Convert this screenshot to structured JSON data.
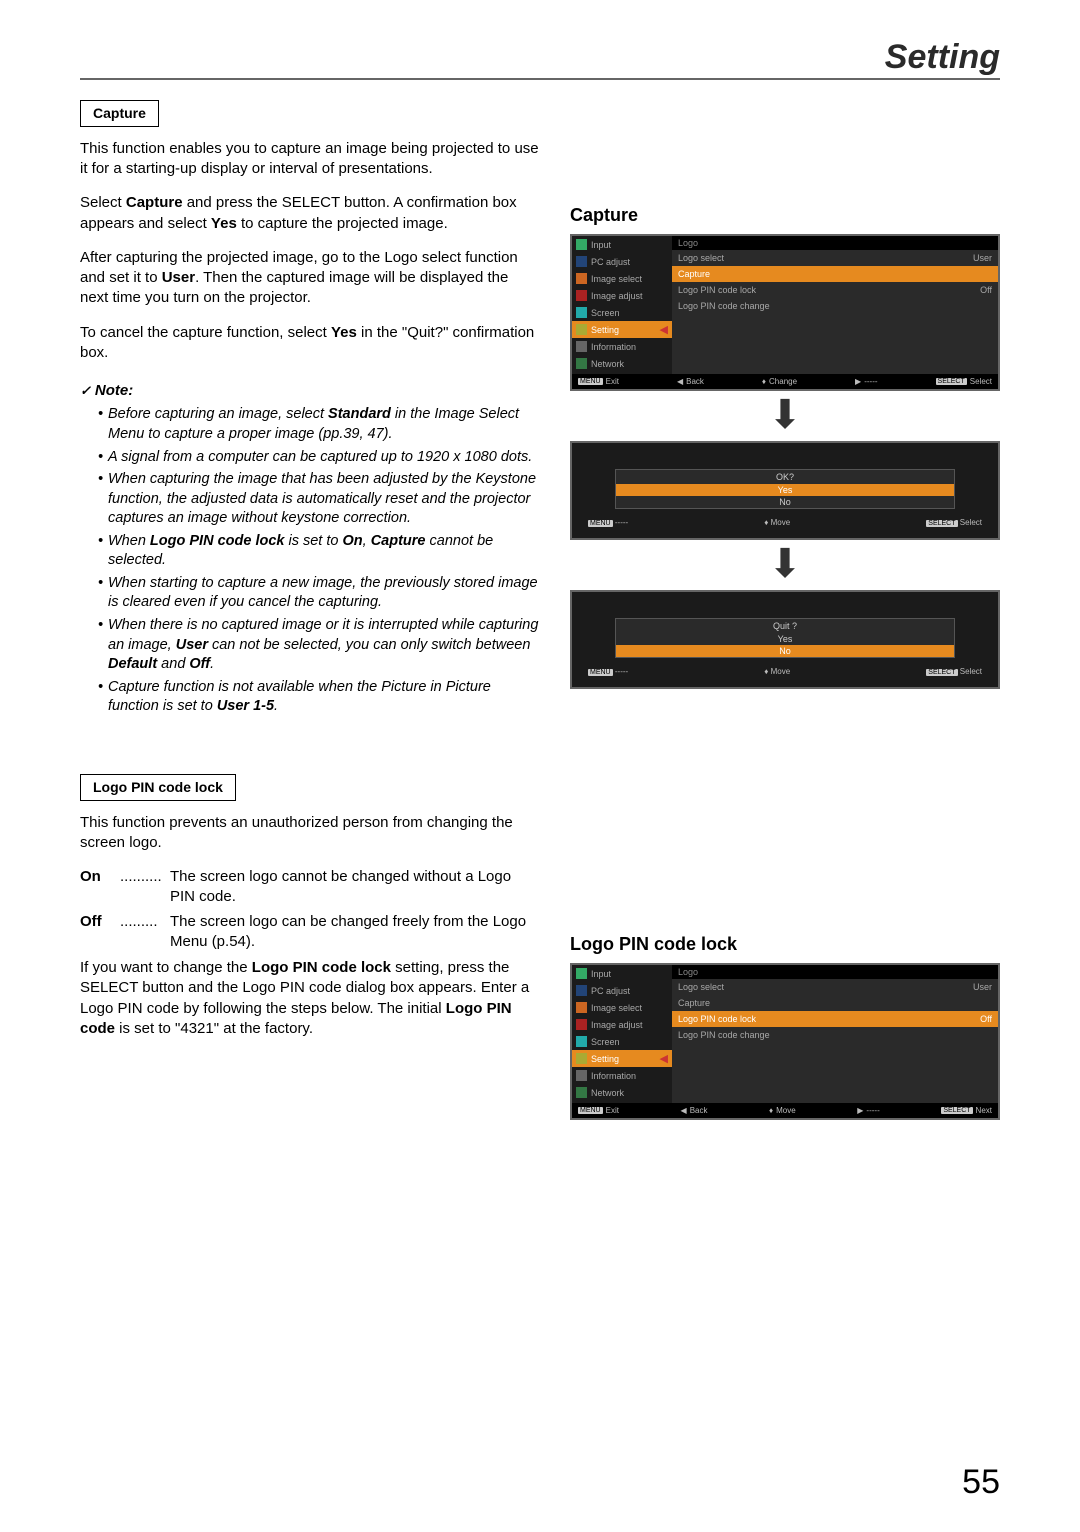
{
  "header": {
    "title": "Setting"
  },
  "page_number": "55",
  "capture_section": {
    "label": "Capture",
    "intro": "This function enables you to capture an image being projected to use it for a starting-up display or interval of presentations.",
    "p1": "Select Capture and press the SELECT button. A confirmation box appears and select Yes to capture the projected image.",
    "p2": "After capturing the projected image, go to the Logo select function and set it to User. Then the captured image will be displayed the next time you turn on the projector.",
    "p3": "To cancel the capture function, select Yes in the \"Quit?\" confirmation box.",
    "note_heading": "Note:",
    "notes": [
      "Before capturing an image, select Standard in the Image Select Menu to capture a proper image (pp.39, 47).",
      "A signal from a computer can be captured up to 1920 x 1080 dots.",
      "When capturing the image that has been adjusted by the Keystone function, the adjusted data is automatically reset and the projector captures an image without keystone correction.",
      "When Logo PIN code lock is set to On, Capture cannot be selected.",
      "When starting to capture a new image, the previously stored image is cleared even if you cancel the capturing.",
      "When there is no captured image or it is interrupted while capturing an image, User can not be selected, you can only switch between Default and Off.",
      "Capture function is not available when the Picture in Picture function is set to User 1-5."
    ]
  },
  "logo_section": {
    "label": "Logo PIN code lock",
    "intro": "This function prevents an unauthorized person from changing the screen logo.",
    "on_label": "On",
    "on_text": "The screen logo cannot be changed without a Logo PIN code.",
    "off_label": "Off",
    "off_text": "The screen logo can be changed freely from the Logo Menu (p.54).",
    "p_after": "If you want to change the Logo PIN code lock setting, press the SELECT button and the Logo PIN code dialog box appears. Enter a Logo PIN code by following the steps below. The initial Logo PIN code is set to \"4321\" at the factory."
  },
  "right": {
    "capture_heading": "Capture",
    "logo_heading": "Logo PIN code lock"
  },
  "menu": {
    "sidebar": [
      {
        "label": "Input",
        "ico": "ico-green"
      },
      {
        "label": "PC adjust",
        "ico": "ico-blue"
      },
      {
        "label": "Image select",
        "ico": "ico-orange"
      },
      {
        "label": "Image adjust",
        "ico": "ico-red"
      },
      {
        "label": "Screen",
        "ico": "ico-cyan"
      },
      {
        "label": "Setting",
        "ico": "ico-yellow",
        "selected": true
      },
      {
        "label": "Information",
        "ico": "ico-grey"
      },
      {
        "label": "Network",
        "ico": "ico-net"
      }
    ],
    "logo_header": "Logo",
    "options_capture": [
      {
        "label": "Logo select",
        "value": "User"
      },
      {
        "label": "Capture",
        "value": "",
        "selected": true
      },
      {
        "label": "Logo PIN code lock",
        "value": "Off"
      },
      {
        "label": "Logo PIN code change",
        "value": ""
      }
    ],
    "options_logolock": [
      {
        "label": "Logo select",
        "value": "User"
      },
      {
        "label": "Capture",
        "value": ""
      },
      {
        "label": "Logo PIN code lock",
        "value": "Off",
        "selected": true
      },
      {
        "label": "Logo PIN code change",
        "value": ""
      }
    ],
    "footer_capture": {
      "exit": "Exit",
      "back": "Back",
      "change": "Change",
      "dash": "-----",
      "select": "Select"
    },
    "footer_logo": {
      "exit": "Exit",
      "back": "Back",
      "move": "Move",
      "dash": "-----",
      "next": "Next"
    },
    "ok_dialog": {
      "title": "OK?",
      "yes": "Yes",
      "no": "No",
      "foot_dash": "-----",
      "foot_move": "Move",
      "foot_select": "Select"
    },
    "quit_dialog": {
      "title": "Quit ?",
      "yes": "Yes",
      "no": "No",
      "foot_dash": "-----",
      "foot_move": "Move",
      "foot_select": "Select"
    },
    "menu_btn": "MENU",
    "select_btn": "SELECT"
  }
}
